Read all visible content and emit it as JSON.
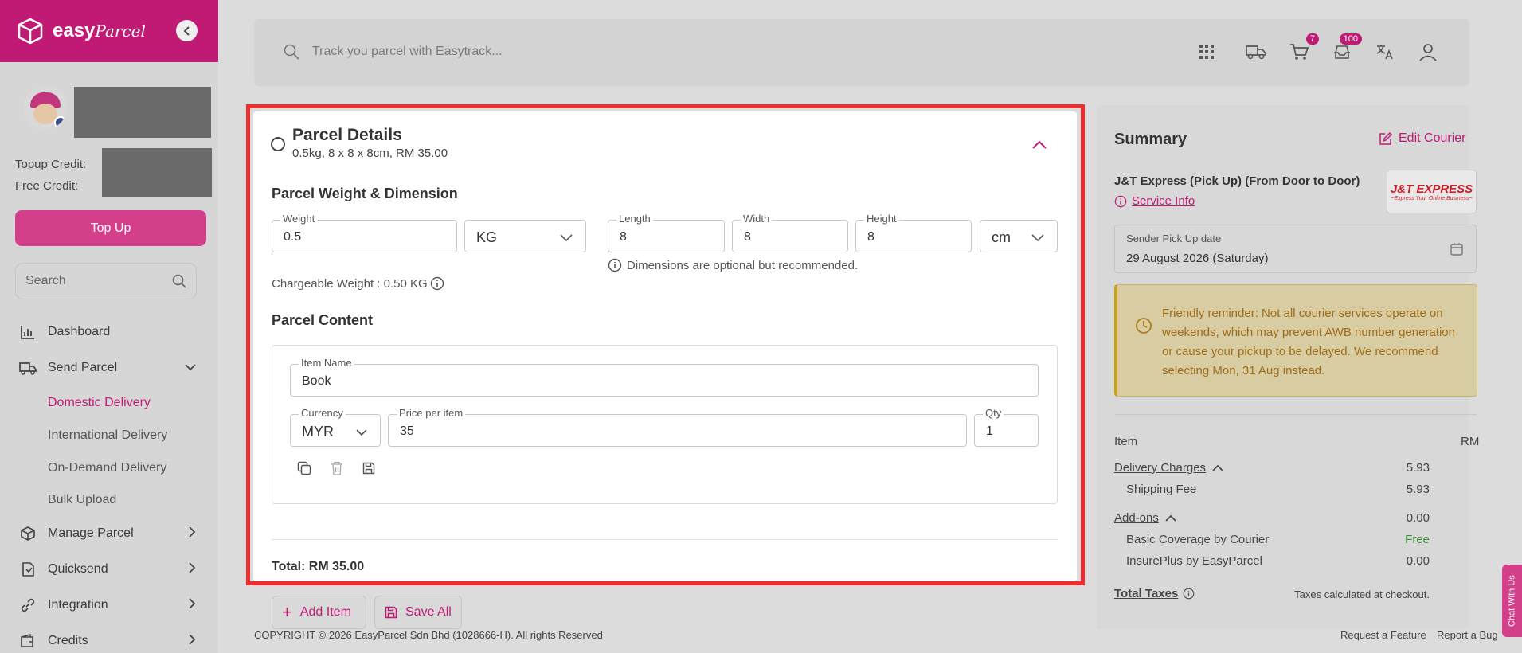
{
  "brand": {
    "name": "easy",
    "name_script": "Parcel"
  },
  "sidebar": {
    "credits": {
      "topup_label": "Topup Credit:",
      "free_label": "Free Credit:"
    },
    "topup_button": "Top Up",
    "search_placeholder": "Search",
    "nav": [
      {
        "label": "Dashboard",
        "icon": "bar-chart-icon"
      },
      {
        "label": "Send Parcel",
        "icon": "truck-icon",
        "expanded": true
      },
      {
        "label": "Manage Parcel",
        "icon": "box-icon"
      },
      {
        "label": "Quicksend",
        "icon": "quicksend-icon"
      },
      {
        "label": "Integration",
        "icon": "link-icon"
      },
      {
        "label": "Credits",
        "icon": "wallet-icon"
      }
    ],
    "send_parcel_sub": [
      "Domestic Delivery",
      "International Delivery",
      "On-Demand Delivery",
      "Bulk Upload"
    ],
    "active_sub": "Domestic Delivery"
  },
  "topbar": {
    "search_placeholder": "Track you parcel with Easytrack...",
    "cart_count": "7",
    "notification_count": "100"
  },
  "parcel": {
    "title": "Parcel Details",
    "subtitle": "0.5kg, 8 x 8 x 8cm, RM 35.00",
    "weight_section": "Parcel Weight & Dimension",
    "weight": {
      "label": "Weight",
      "value": "0.5"
    },
    "weight_unit": "KG",
    "length": {
      "label": "Length",
      "value": "8"
    },
    "width": {
      "label": "Width",
      "value": "8"
    },
    "height": {
      "label": "Height",
      "value": "8"
    },
    "dim_unit": "cm",
    "dim_hint": "Dimensions are optional but recommended.",
    "chargeable": "Chargeable Weight : 0.50 KG",
    "content_section": "Parcel Content",
    "item_name": {
      "label": "Item Name",
      "value": "Book"
    },
    "currency": {
      "label": "Currency",
      "value": "MYR"
    },
    "price": {
      "label": "Price per item",
      "value": "35"
    },
    "qty": {
      "label": "Qty",
      "value": "1"
    },
    "total": "Total: RM 35.00"
  },
  "actions": {
    "add_item": "Add Item",
    "save_all": "Save All"
  },
  "footer": {
    "copyright": "COPYRIGHT © 2026 EasyParcel Sdn Bhd (1028666-H). All rights Reserved",
    "request_feature": "Request a Feature",
    "report_bug": "Report a Bug"
  },
  "summary": {
    "title": "Summary",
    "edit_courier": "Edit Courier",
    "courier_name": "J&T Express (Pick Up) (From Door to Door)",
    "service_info": "Service Info",
    "courier_logo_text": "J&T EXPRESS",
    "courier_logo_tagline": "~Express Your Online Business~",
    "pickup": {
      "label": "Sender Pick Up date",
      "value": "29 August 2026 (Saturday)"
    },
    "reminder": "Friendly reminder: Not all courier services operate on weekends, which may prevent AWB number generation or cause your pickup to be delayed. We recommend selecting Mon, 31 Aug instead.",
    "item_header": "Item",
    "currency_header": "RM",
    "delivery_charges": {
      "label": "Delivery Charges",
      "value": "5.93"
    },
    "shipping_fee": {
      "label": "Shipping Fee",
      "value": "5.93"
    },
    "addons": {
      "label": "Add-ons",
      "value": "0.00"
    },
    "basic_coverage": {
      "label": "Basic Coverage by Courier",
      "value": "Free"
    },
    "insureplus": {
      "label": "InsurePlus by EasyParcel",
      "value": "0.00"
    },
    "total_taxes": {
      "label": "Total Taxes",
      "note": "Taxes calculated at checkout."
    }
  },
  "chat": {
    "label": "Chat With Us"
  },
  "colors": {
    "brand": "#c11a75",
    "highlight": "#ee2e2e",
    "free": "#3a8a3a"
  }
}
